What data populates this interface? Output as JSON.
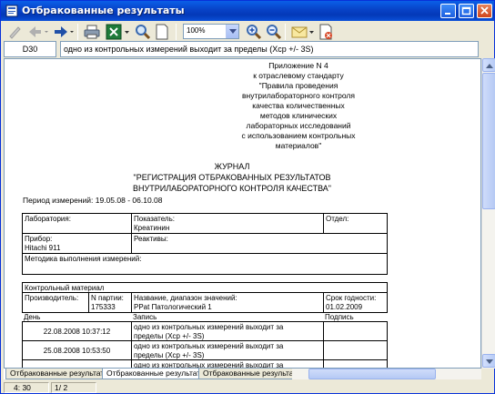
{
  "window": {
    "title": "Отбракованные результаты"
  },
  "toolbar": {
    "zoom": "100%"
  },
  "cellbar": {
    "ref": "D30",
    "value": "одно из контрольных измерений выходит за пределы (Xср +/- 3S)"
  },
  "document": {
    "appendix": [
      "Приложение N 4",
      "к отраслевому стандарту",
      "\"Правила проведения",
      "внутрилабораторного контроля",
      "качества количественных",
      "методов клинических",
      "лабораторных исследований",
      "с использованием контрольных",
      "материалов\""
    ],
    "journal": [
      "ЖУРНАЛ",
      "\"РЕГИСТРАЦИЯ ОТБРАКОВАННЫХ РЕЗУЛЬТАТОВ",
      "ВНУТРИЛАБОРАТОРНОГО КОНТРОЛЯ КАЧЕСТВА\""
    ],
    "period": "Период измерений: 19.05.08 - 06.10.08",
    "table1": {
      "lab_label": "Лаборатория:",
      "indicator_label": "Показатель:",
      "indicator_value": "Креатинин",
      "dept_label": "Отдел:",
      "device_label": "Прибор:",
      "device_value": "Hitachi 911",
      "reagents_label": "Реактивы:",
      "method_label": "Методика выполнения измерений:"
    },
    "table2": {
      "control_label": "Контрольный материал",
      "maker_label": "Производитель:",
      "batch_label": "N партии:",
      "batch_value": "175333",
      "name_label": "Название, диапазон значений:",
      "name_value": "PPat Патологический 1",
      "expiry_label": "Срок годности:",
      "expiry_value": "01.02.2009",
      "col_day": "День",
      "col_record": "Запись",
      "col_signature": "Подпись",
      "rows": [
        {
          "day": "22.08.2008 10:37:12",
          "record1": "одно из контрольных измерений выходит за",
          "record2": "пределы (Xср +/- 3S)"
        },
        {
          "day": "25.08.2008 10:53:50",
          "record1": "одно из контрольных измерений выходит за",
          "record2": "пределы (Xср +/- 3S)"
        },
        {
          "day": "",
          "record1": "одно из контрольных измерений выходит за",
          "record2": ""
        }
      ]
    }
  },
  "tabs": [
    "Отбракованные результаты",
    "Отбракованные результаты",
    "Отбракованные результаты"
  ],
  "status": {
    "position": "4: 30",
    "page": "1/ 2"
  },
  "colors": {
    "title_bar": "#0842c6",
    "chrome": "#ece9d8",
    "border": "#7f9db9"
  }
}
